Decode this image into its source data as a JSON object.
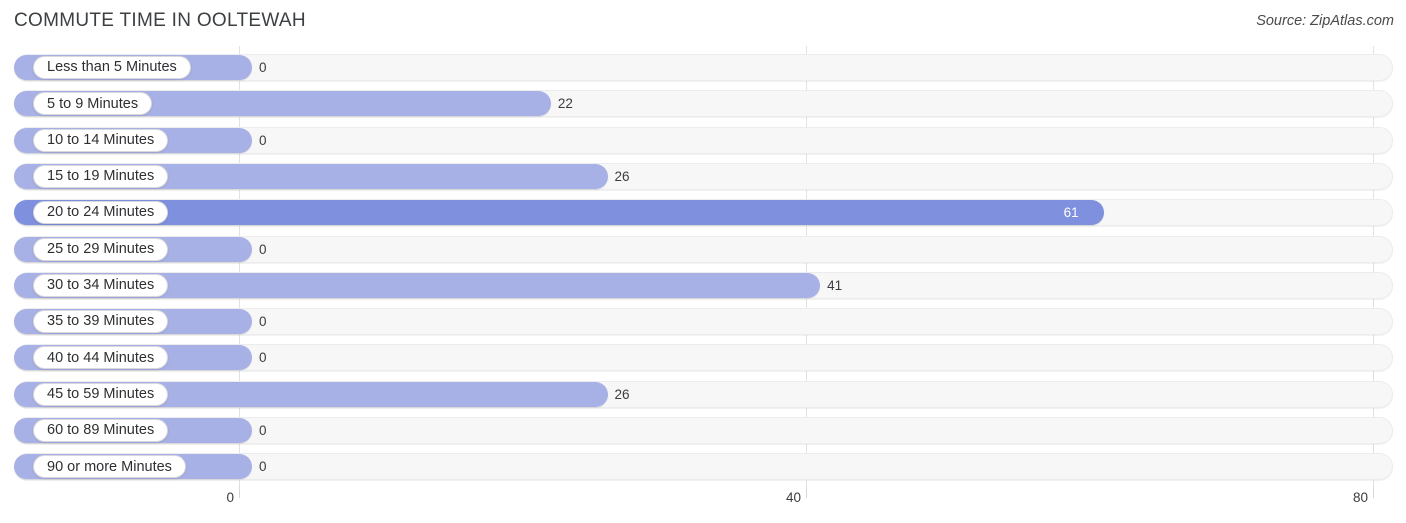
{
  "header": {
    "title": "COMMUTE TIME IN OOLTEWAH",
    "source": "Source: ZipAtlas.com"
  },
  "colors": {
    "bar": "#a8b1e5",
    "bar_highlight": "#7e90de",
    "track": "#f7f7f8",
    "gridline": "#e2e2e4",
    "text": "#3c3c40"
  },
  "chart_data": {
    "type": "bar",
    "orientation": "horizontal",
    "title": "COMMUTE TIME IN OOLTEWAH",
    "xlabel": "",
    "ylabel": "",
    "xlim": [
      0,
      80
    ],
    "xticks": [
      0,
      40,
      80
    ],
    "xtick_labels": [
      "0",
      "40",
      "80"
    ],
    "grid": true,
    "legend": false,
    "categories": [
      "Less than 5 Minutes",
      "5 to 9 Minutes",
      "10 to 14 Minutes",
      "15 to 19 Minutes",
      "20 to 24 Minutes",
      "25 to 29 Minutes",
      "30 to 34 Minutes",
      "35 to 39 Minutes",
      "40 to 44 Minutes",
      "45 to 59 Minutes",
      "60 to 89 Minutes",
      "90 or more Minutes"
    ],
    "values": [
      0,
      22,
      0,
      26,
      61,
      0,
      41,
      0,
      0,
      26,
      0,
      0
    ],
    "value_labels": [
      "0",
      "22",
      "0",
      "26",
      "61",
      "0",
      "41",
      "0",
      "0",
      "26",
      "0",
      "0"
    ],
    "max_value": 61,
    "highlight_index": 4
  }
}
